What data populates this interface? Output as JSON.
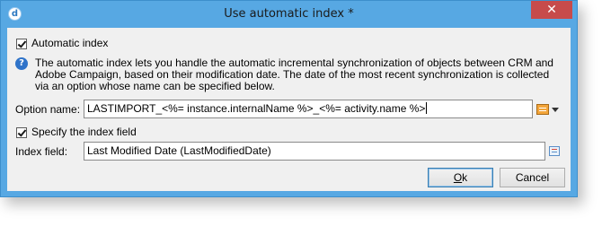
{
  "window": {
    "title": "Use automatic index *",
    "close_glyph": "✕",
    "app_icon_glyph": "d"
  },
  "automatic_index": {
    "label": "Automatic index",
    "checked": true
  },
  "help": {
    "icon_glyph": "?",
    "description": "The automatic index lets you handle the automatic incremental synchronization of objects between CRM and Adobe Campaign, based on their modification date. The date of the most recent synchronization is collected via an option whose name can be specified below."
  },
  "option_name": {
    "label": "Option name:",
    "value": "LASTIMPORT_<%= instance.internalName %>_<%= activity.name %>"
  },
  "specify_index": {
    "label": "Specify the index field",
    "checked": true
  },
  "index_field": {
    "label": "Index field:",
    "value": "Last Modified Date (LastModifiedDate)"
  },
  "buttons": {
    "ok_mnemonic": "O",
    "ok_rest": "k",
    "cancel": "Cancel"
  }
}
